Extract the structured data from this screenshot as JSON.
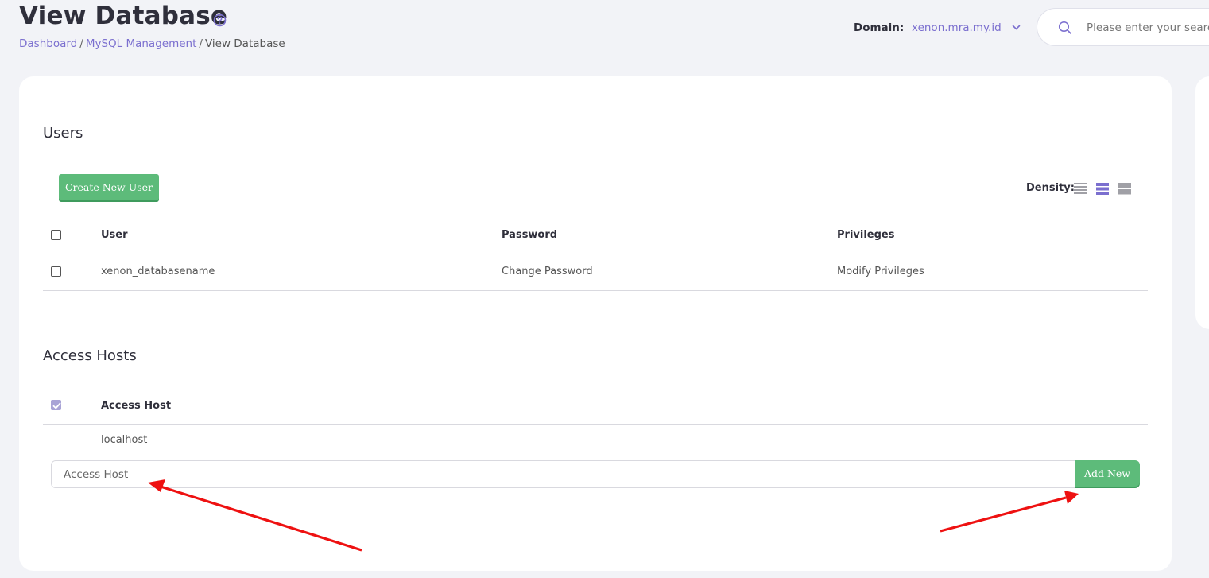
{
  "header": {
    "title": "View Database",
    "breadcrumb": [
      "Dashboard",
      "MySQL Management",
      "View Database"
    ],
    "domain_label": "Domain:",
    "domain_value": "xenon.mra.my.id",
    "search_placeholder": "Please enter your search"
  },
  "users": {
    "title": "Users",
    "create_button": "Create New User",
    "density_label": "Density:",
    "columns": [
      "User",
      "Password",
      "Privileges"
    ],
    "rows": [
      {
        "user": "xenon_databasename",
        "password": "Change Password",
        "privileges": "Modify Privileges"
      }
    ]
  },
  "access_hosts": {
    "title": "Access Hosts",
    "column": "Access Host",
    "rows": [
      "localhost"
    ],
    "input_placeholder": "Access Host",
    "add_button": "Add New"
  },
  "colors": {
    "accent": "#7b6fcf",
    "button_green": "#5dbb7a",
    "annotation_arrow": "#ee1111"
  }
}
